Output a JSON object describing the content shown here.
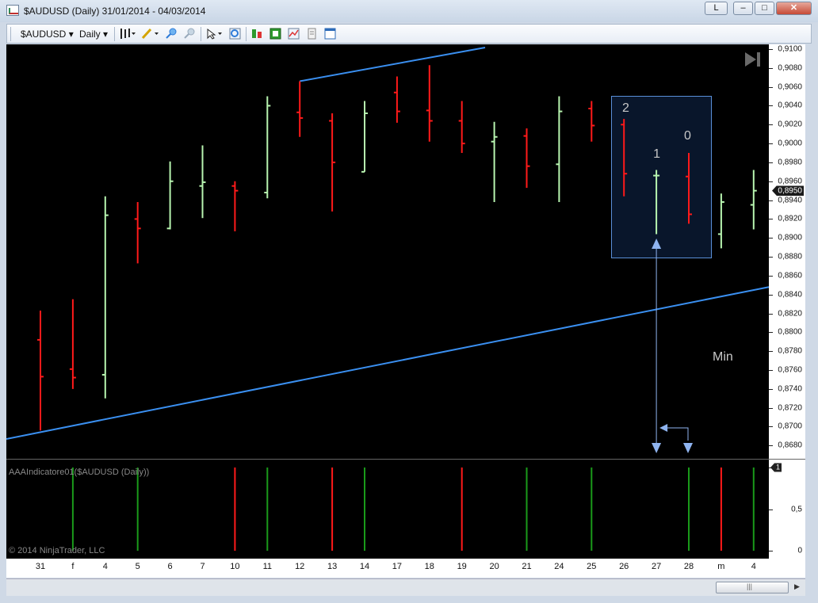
{
  "window": {
    "title": "$AUDUSD (Daily)  31/01/2014 - 04/03/2014",
    "btn_link": "L",
    "btn_min": "–",
    "btn_max": "□",
    "btn_close": "✕"
  },
  "toolbar": {
    "instrument": "$AUDUSD",
    "period": "Daily",
    "dropdown_glyph": "▾"
  },
  "copyright": "© 2014 NinjaTrader, LLC",
  "indicator_label": "AAAIndicatore01($AUDUSD (Daily))",
  "annotations": {
    "label_2": "2",
    "label_1": "1",
    "label_0": "0",
    "label_min": "Min"
  },
  "colors": {
    "up": "#b8f5b0",
    "down": "#ff1a1a",
    "ind_up": "#1a9a1a",
    "ind_down": "#ff1a1a",
    "trendline": "#3a8ff0",
    "highlight_border": "#5a8fd8",
    "arrow": "#8fb4f0"
  },
  "chart_data": [
    {
      "type": "ohlc",
      "instrument": "$AUDUSD",
      "interval": "Daily",
      "categories": [
        "31",
        "f",
        "4",
        "5",
        "6",
        "7",
        "10",
        "11",
        "12",
        "13",
        "14",
        "17",
        "18",
        "19",
        "20",
        "21",
        "24",
        "25",
        "26",
        "27",
        "28",
        "m",
        "4"
      ],
      "ohlc": [
        {
          "x": "31",
          "open": 0.8792,
          "high": 0.8823,
          "low": 0.8696,
          "close": 0.8753
        },
        {
          "x": "f",
          "open": 0.8761,
          "high": 0.8835,
          "low": 0.874,
          "close": 0.8752
        },
        {
          "x": "4",
          "open": 0.8755,
          "high": 0.8944,
          "low": 0.873,
          "close": 0.8924
        },
        {
          "x": "5",
          "open": 0.892,
          "high": 0.8938,
          "low": 0.8873,
          "close": 0.891
        },
        {
          "x": "6",
          "open": 0.891,
          "high": 0.8981,
          "low": 0.8909,
          "close": 0.896
        },
        {
          "x": "7",
          "open": 0.8955,
          "high": 0.8998,
          "low": 0.8921,
          "close": 0.8959
        },
        {
          "x": "10",
          "open": 0.8955,
          "high": 0.896,
          "low": 0.8907,
          "close": 0.895
        },
        {
          "x": "11",
          "open": 0.8948,
          "high": 0.905,
          "low": 0.8942,
          "close": 0.904
        },
        {
          "x": "12",
          "open": 0.9033,
          "high": 0.9066,
          "low": 0.9007,
          "close": 0.9027
        },
        {
          "x": "13",
          "open": 0.9024,
          "high": 0.9032,
          "low": 0.8928,
          "close": 0.898
        },
        {
          "x": "14",
          "open": 0.897,
          "high": 0.9045,
          "low": 0.897,
          "close": 0.9032
        },
        {
          "x": "17",
          "open": 0.9054,
          "high": 0.9071,
          "low": 0.9022,
          "close": 0.9034
        },
        {
          "x": "18",
          "open": 0.9035,
          "high": 0.9083,
          "low": 0.9002,
          "close": 0.9024
        },
        {
          "x": "19",
          "open": 0.9024,
          "high": 0.9045,
          "low": 0.899,
          "close": 0.9
        },
        {
          "x": "20",
          "open": 0.9002,
          "high": 0.9023,
          "low": 0.8938,
          "close": 0.9007
        },
        {
          "x": "21",
          "open": 0.9008,
          "high": 0.9016,
          "low": 0.8953,
          "close": 0.8976
        },
        {
          "x": "24",
          "open": 0.8978,
          "high": 0.905,
          "low": 0.8938,
          "close": 0.9034
        },
        {
          "x": "25",
          "open": 0.9037,
          "high": 0.9045,
          "low": 0.9002,
          "close": 0.9019
        },
        {
          "x": "26",
          "open": 0.902,
          "high": 0.9026,
          "low": 0.8944,
          "close": 0.8968
        },
        {
          "x": "27",
          "open": 0.8966,
          "high": 0.8972,
          "low": 0.8904,
          "close": 0.8966
        },
        {
          "x": "28",
          "open": 0.8965,
          "high": 0.899,
          "low": 0.8915,
          "close": 0.8925
        },
        {
          "x": "m",
          "open": 0.8904,
          "high": 0.8947,
          "low": 0.8889,
          "close": 0.8938
        },
        {
          "x": "4",
          "open": 0.8935,
          "high": 0.8972,
          "low": 0.8909,
          "close": 0.895
        }
      ],
      "last_price": "0,8950",
      "y_ticks": [
        "0,8680",
        "0,8700",
        "0,8720",
        "0,8740",
        "0,8760",
        "0,8780",
        "0,8800",
        "0,8820",
        "0,8840",
        "0,8860",
        "0,8880",
        "0,8900",
        "0,8920",
        "0,8940",
        "0,8960",
        "0,8980",
        "0,9000",
        "0,9020",
        "0,9040",
        "0,9060",
        "0,9080",
        "0,9100"
      ],
      "ylim": [
        0.8666,
        0.9105
      ],
      "trendlines": [
        {
          "from": {
            "x": "31",
            "y": 0.8696
          },
          "to": {
            "x": "4",
            "y": 0.8848
          }
        },
        {
          "from": {
            "x": "12",
            "y": 0.9066
          },
          "to": {
            "x": "24",
            "y": 0.9106
          }
        }
      ]
    },
    {
      "type": "bar",
      "name": "AAAIndicatore01($AUDUSD (Daily))",
      "categories": [
        "f",
        "5",
        "10",
        "11",
        "13",
        "14",
        "19",
        "21",
        "25",
        "28",
        "m",
        "4"
      ],
      "values": [
        1,
        1,
        1,
        1,
        1,
        1,
        1,
        1,
        1,
        1,
        1,
        1
      ],
      "direction": [
        "up",
        "up",
        "down",
        "up",
        "down",
        "up",
        "down",
        "up",
        "up",
        "up",
        "down",
        "up"
      ],
      "y_ticks": [
        "0",
        "0,5",
        "1"
      ],
      "ylim": [
        0,
        1
      ]
    }
  ]
}
